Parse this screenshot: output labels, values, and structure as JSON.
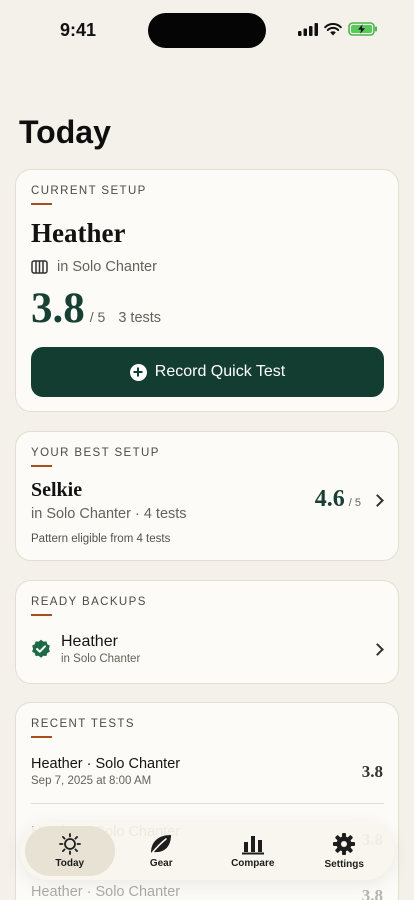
{
  "status_bar": {
    "time": "9:41"
  },
  "page_title": "Today",
  "current_setup": {
    "eyebrow": "CURRENT SETUP",
    "name": "Heather",
    "location": "in Solo Chanter",
    "score": "3.8",
    "scale": "/ 5",
    "tests": "3 tests",
    "button_label": "Record Quick Test"
  },
  "best_setup": {
    "eyebrow": "YOUR BEST SETUP",
    "name": "Selkie",
    "meta": "in Solo Chanter · 4 tests",
    "score": "4.6",
    "scale": "/ 5",
    "note": "Pattern eligible from 4 tests"
  },
  "ready_backups": {
    "eyebrow": "READY BACKUPS",
    "items": [
      {
        "name": "Heather",
        "sub": "in Solo Chanter"
      }
    ]
  },
  "recent_tests": {
    "eyebrow": "RECENT TESTS",
    "items": [
      {
        "title": "Heather · Solo Chanter",
        "date": "Sep 7, 2025 at 8:00 AM",
        "score": "3.8"
      },
      {
        "title": "Heather · Solo Chanter",
        "date": "",
        "score": "3.8"
      }
    ]
  },
  "tabbar": {
    "tabs": [
      {
        "label": "Today",
        "icon": "sun-icon",
        "active": true
      },
      {
        "label": "Gear",
        "icon": "leaf-icon",
        "active": false
      },
      {
        "label": "Compare",
        "icon": "bar-chart-icon",
        "active": false
      },
      {
        "label": "Settings",
        "icon": "gear-icon",
        "active": false
      }
    ]
  },
  "colors": {
    "background": "#f4f1ea",
    "card": "#fdfbf7",
    "primary": "#133d31",
    "accent_rule": "#a5501e",
    "check_green": "#1d6a45"
  }
}
